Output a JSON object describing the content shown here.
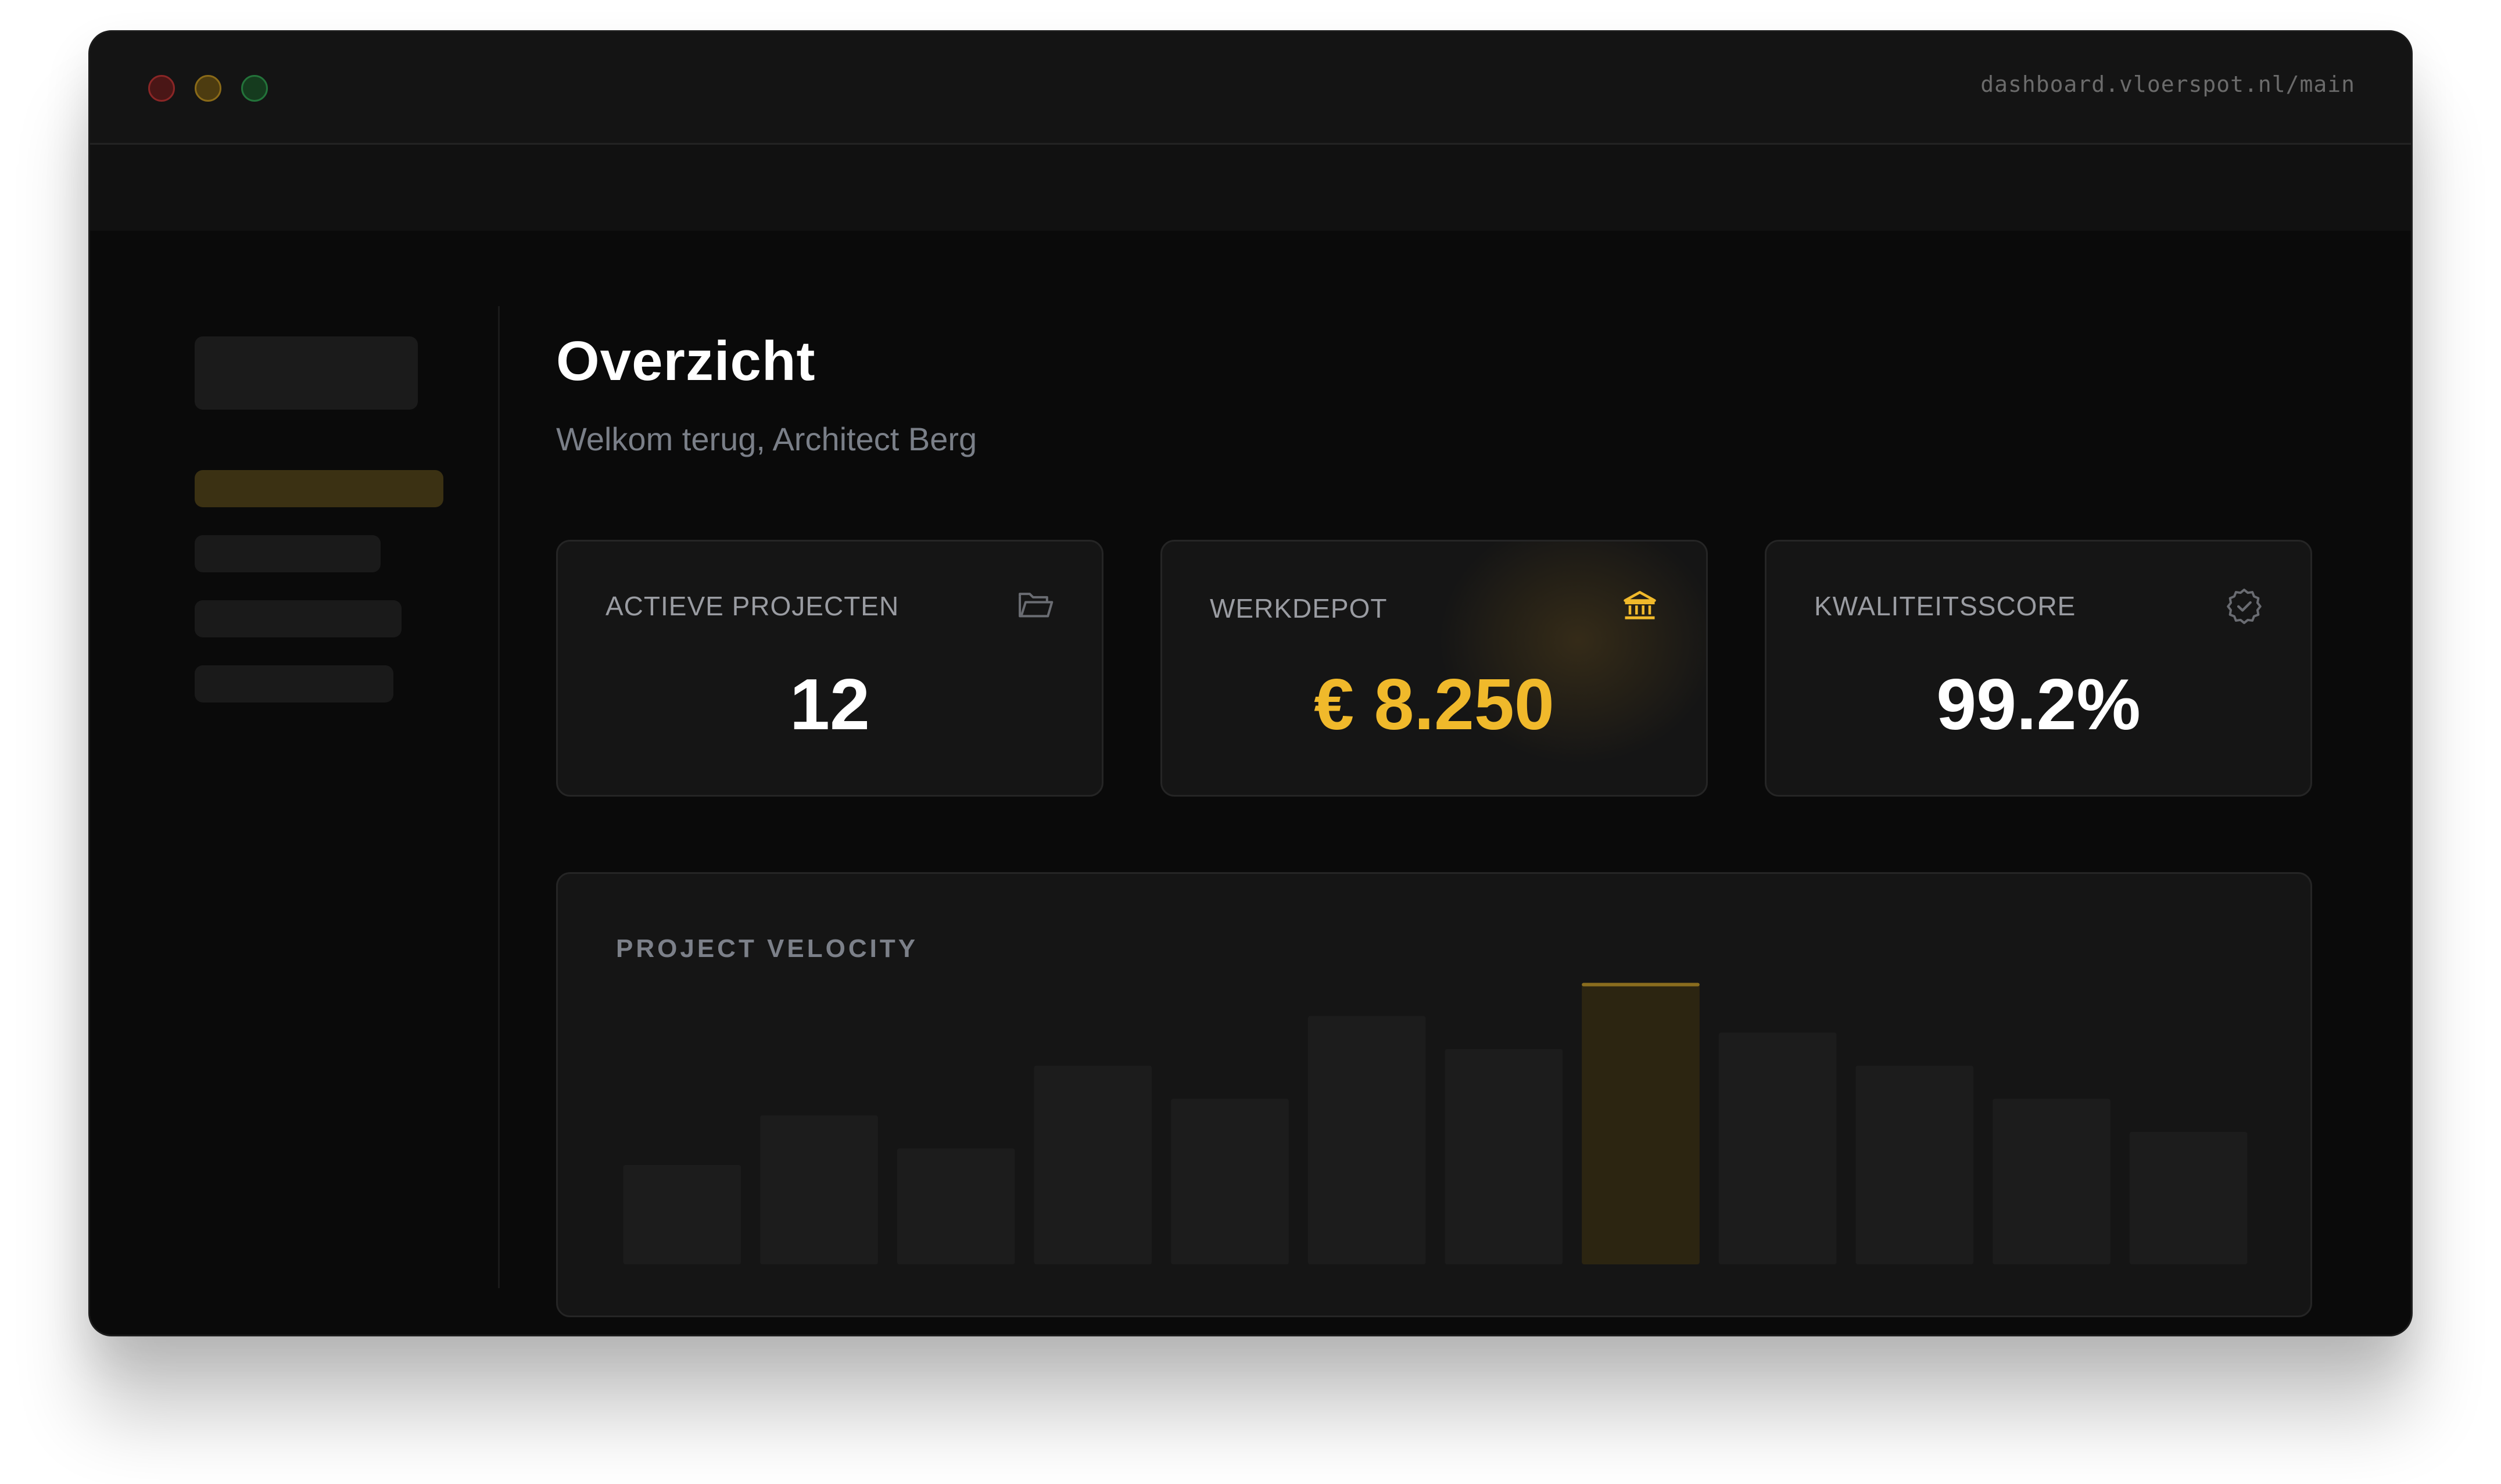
{
  "window": {
    "url": "dashboard.vloerspot.nl/main"
  },
  "page": {
    "title": "Overzicht",
    "subtitle": "Welkom terug, Architect Berg"
  },
  "cards": [
    {
      "label": "ACTIEVE PROJECTEN",
      "value": "12",
      "icon": "folder-icon"
    },
    {
      "label": "WERKDEPOT",
      "value": "€ 8.250",
      "icon": "bank-icon"
    },
    {
      "label": "KWALITEITSSCORE",
      "value": "99.2%",
      "icon": "verified-badge-icon"
    }
  ],
  "colors": {
    "accent": "#f0b92b",
    "bar": "#1c1c1c",
    "bar_highlight": "#2c2511",
    "bar_highlight_top": "#8a6d1e"
  },
  "chart_data": {
    "type": "bar",
    "title": "PROJECT VELOCITY",
    "values": [
      30,
      45,
      35,
      60,
      50,
      75,
      65,
      85,
      70,
      60,
      50,
      40
    ],
    "highlight_index": 7,
    "ylim": [
      0,
      100
    ],
    "grid": false
  }
}
